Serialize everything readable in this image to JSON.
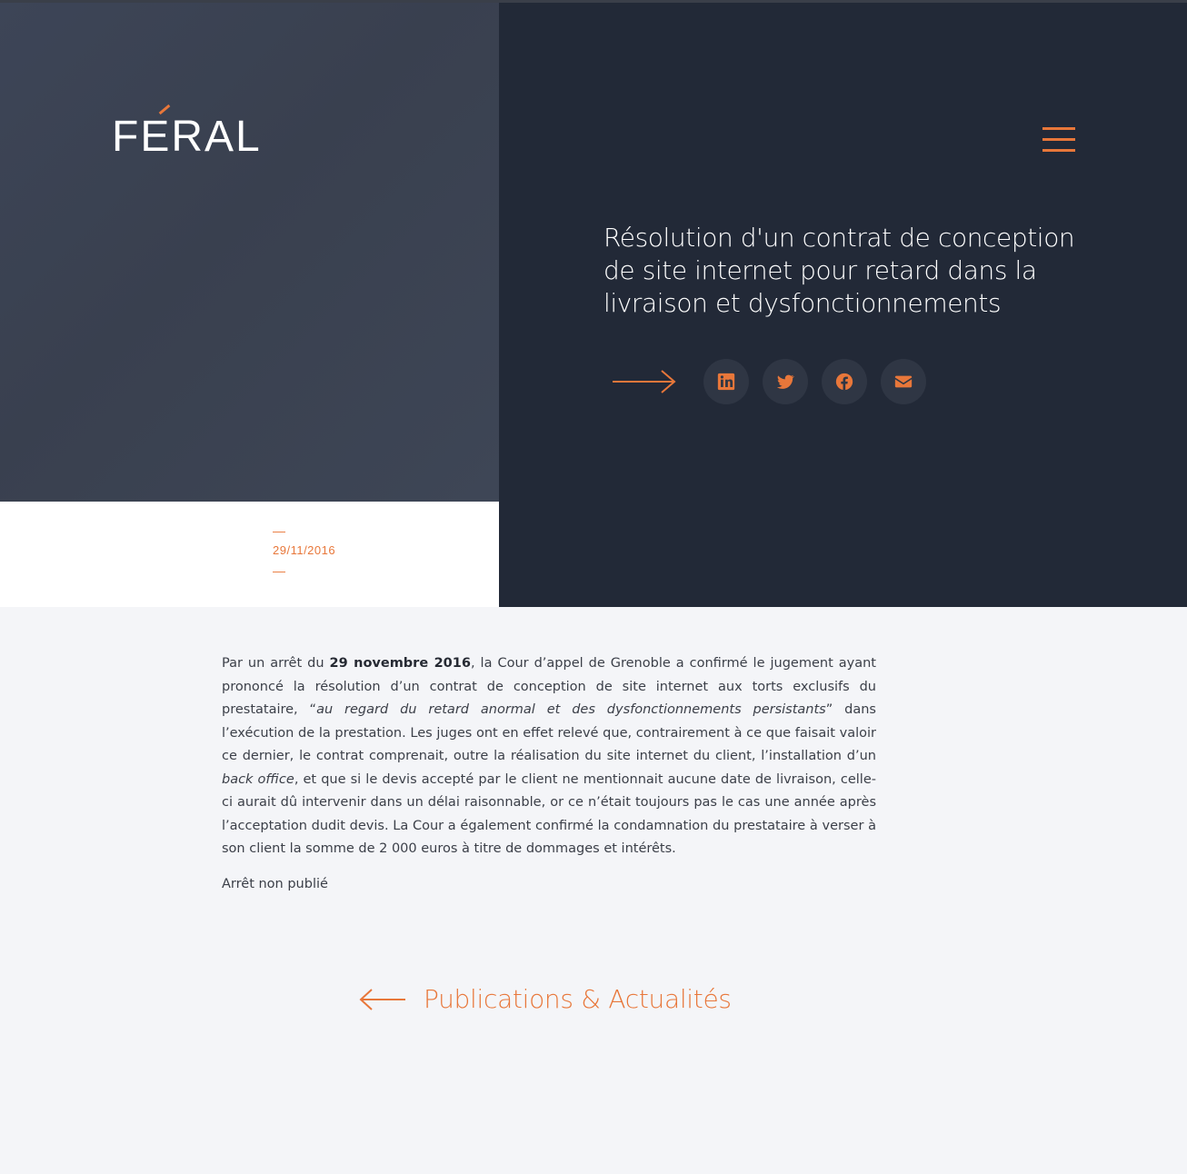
{
  "brand": {
    "logo_text": "FERAL",
    "accent_color": "#e8773a"
  },
  "colors": {
    "dark_navy": "#222937",
    "hero_slate": "#3d4557",
    "page_bg": "#f4f5f8"
  },
  "header": {
    "menu_icon": "hamburger-menu-icon"
  },
  "article": {
    "title": "Résolution d'un contrat de conception de site internet pour retard dans la livraison et dysfonctionnements",
    "date_dash_top": "—",
    "date": "29/11/2016",
    "date_dash_bottom": "—",
    "p1_a": "Par un arrêt du ",
    "p1_bold": "29 novembre 2016",
    "p1_b": ", la Cour d’appel de Grenoble a confirmé le jugement ayant prononcé la résolution d’un contrat de conception de site internet aux torts exclusifs du prestataire, “",
    "p1_em": "au regard du retard anormal et des dysfonctionnements persistants",
    "p1_c": "” dans l’exécution de la prestation. Les juges ont en effet relevé que, contrairement à ce que faisait valoir ce dernier, le contrat comprenait, outre la réalisation du site internet du client, l’installation d’un ",
    "p1_em2": "back office",
    "p1_d": ", et que si le devis accepté par le client ne mentionnait aucune date de livraison, celle-ci aurait dû intervenir dans un délai raisonnable, or ce n’était toujours pas le cas une année après l’acceptation dudit devis.  La Cour a  également  confirmé  la  condamnation du prestataire à verser à son client la somme de 2 000 euros à titre de dommages et intérêts.",
    "p2": "Arrêt non publié"
  },
  "share": {
    "icons": [
      "arrow-right-icon",
      "linkedin-icon",
      "twitter-icon",
      "facebook-icon",
      "email-icon"
    ]
  },
  "footer_nav": {
    "back_label": "Publications & Actualités",
    "back_icon": "arrow-left-icon"
  }
}
